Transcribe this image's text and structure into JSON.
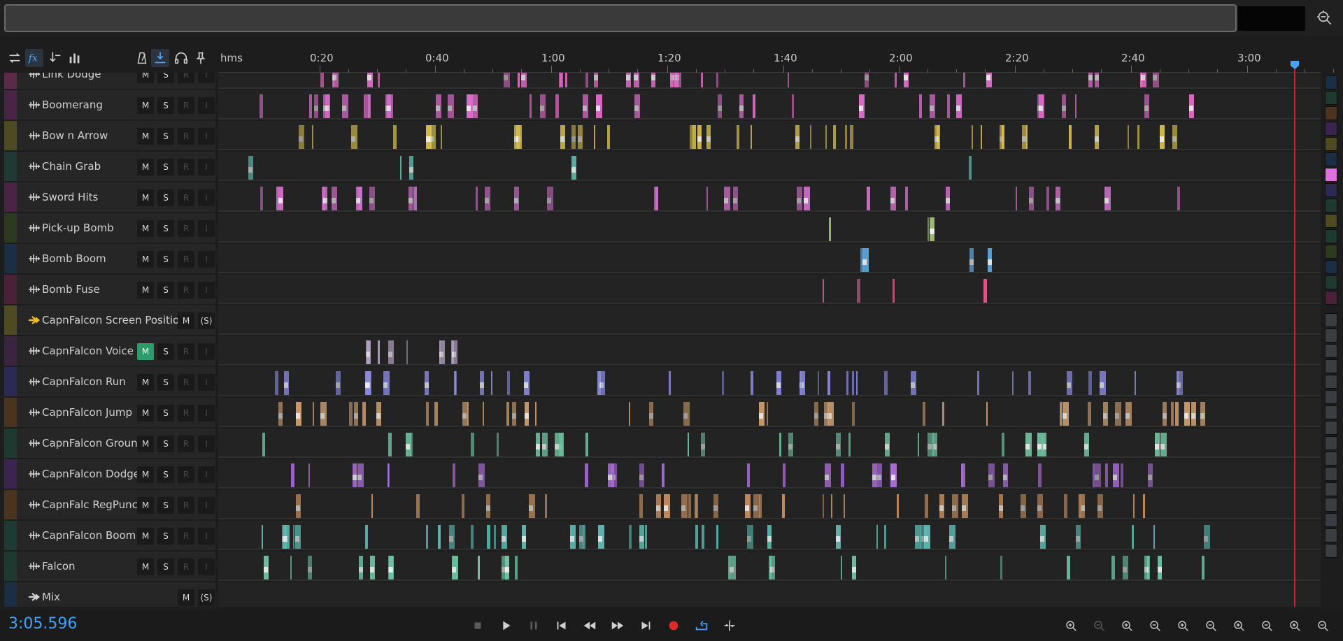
{
  "ruler": {
    "unit_label": "hms",
    "ticks": [
      {
        "label": "0:20"
      },
      {
        "label": "0:40"
      },
      {
        "label": "1:00"
      },
      {
        "label": "1:20"
      },
      {
        "label": "1:40"
      },
      {
        "label": "2:00"
      },
      {
        "label": "2:20"
      },
      {
        "label": "2:40"
      },
      {
        "label": "3:00"
      }
    ]
  },
  "tracks": [
    {
      "name": "Link Dodge",
      "color": "#5a2a48",
      "clip_color": "#e070c8",
      "type": "audio",
      "partial": true
    },
    {
      "name": "Boomerang",
      "color": "#4a2444",
      "clip_color": "#e070d0",
      "type": "audio"
    },
    {
      "name": "Bow n Arrow",
      "color": "#4e4a22",
      "clip_color": "#d8c050",
      "type": "audio"
    },
    {
      "name": "Chain Grab",
      "color": "#1f3a34",
      "clip_color": "#5fc0b0",
      "type": "audio"
    },
    {
      "name": "Sword Hits",
      "color": "#4a2444",
      "clip_color": "#d070c8",
      "type": "audio"
    },
    {
      "name": "Pick-up Bomb",
      "color": "#2e3a20",
      "clip_color": "#9ec070",
      "type": "audio"
    },
    {
      "name": "Bomb Boom",
      "color": "#1c2e44",
      "clip_color": "#5ea8e0",
      "type": "audio"
    },
    {
      "name": "Bomb Fuse",
      "color": "#4a2238",
      "clip_color": "#e06090",
      "type": "audio"
    },
    {
      "name": "CapnFalcon Screen Position",
      "color": "#4e4a22",
      "clip_color": "#d8c050",
      "type": "bus"
    },
    {
      "name": "CapnFalcon Voice",
      "color": "#3a2440",
      "clip_color": "#b0a0c0",
      "type": "audio",
      "mute_on": true
    },
    {
      "name": "CapnFalcon Run",
      "color": "#2a2a54",
      "clip_color": "#8c8ce0",
      "type": "audio"
    },
    {
      "name": "CapnFalcon Jump",
      "color": "#4a3420",
      "clip_color": "#d0a070",
      "type": "audio"
    },
    {
      "name": "CapnFalcon Groun",
      "color": "#1e3a30",
      "clip_color": "#70c0a0",
      "type": "audio"
    },
    {
      "name": "CapnFalcon Dodge",
      "color": "#3a2450",
      "clip_color": "#b070e0",
      "type": "audio"
    },
    {
      "name": "CapnFalc RegPunc",
      "color": "#4a3420",
      "clip_color": "#c89060",
      "type": "audio"
    },
    {
      "name": "CapnFalcon Boom",
      "color": "#1e3a34",
      "clip_color": "#60c0b8",
      "type": "audio"
    },
    {
      "name": "Falcon",
      "color": "#1e3a30",
      "clip_color": "#70c8a8",
      "type": "audio"
    },
    {
      "name": "Mix",
      "color": "#1c2e44",
      "clip_color": "#5ea8e0",
      "type": "mix"
    }
  ],
  "buttons": {
    "mute": "M",
    "solo": "S",
    "record": "R",
    "input": "I",
    "solo_safe": "(S)"
  },
  "toolbar": {
    "icons": [
      "swap-icon",
      "fx-icon",
      "send-icon",
      "meter-icon",
      "metronome-icon",
      "pointer-icon",
      "headphones-icon",
      "pin-icon"
    ]
  },
  "transport": {
    "time": "3:05.596",
    "buttons": [
      "stop",
      "play",
      "pause",
      "to-start",
      "rewind",
      "fast-forward",
      "to-end",
      "record",
      "loop",
      "skip-selection"
    ]
  },
  "colors": {
    "playhead": "#c0282e",
    "time_display": "#3fa3ff",
    "accent": "#2f9b6a"
  },
  "color_strip": [
    "#1c2e44",
    "#1e3a30",
    "#4a3420",
    "#3a2450",
    "#4e4a22",
    "#1c2e44",
    "#e070e0",
    "#2a2a54",
    "#1e3a30",
    "#4e4a22",
    "#1e3a30",
    "#2e3a20",
    "#1c2e44",
    "#1e3a30",
    "#4a2238"
  ]
}
